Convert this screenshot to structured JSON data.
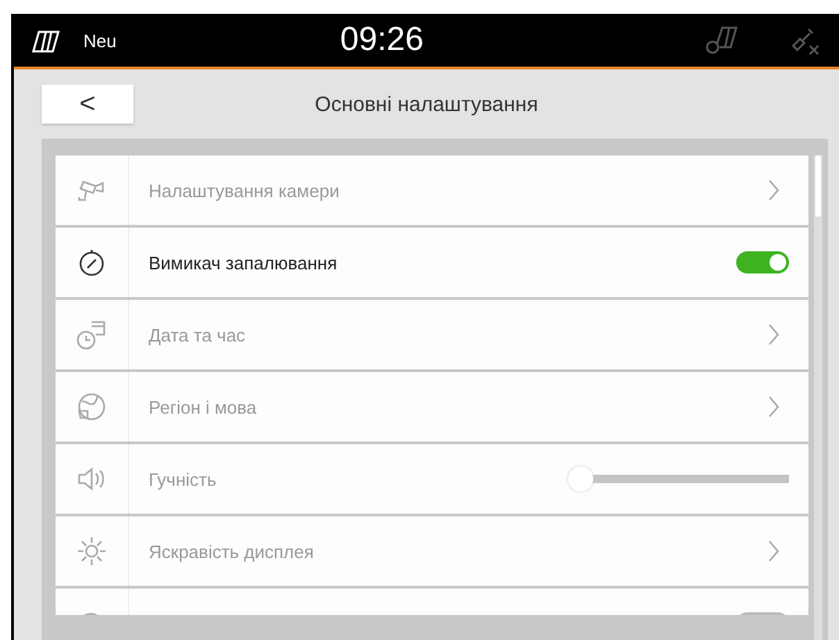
{
  "status_bar": {
    "label": "Neu",
    "time": "09:26"
  },
  "header": {
    "back": "<",
    "title": "Основні налаштування"
  },
  "rows": [
    {
      "kind": "link",
      "label": "Налаштування камери",
      "disabled": true
    },
    {
      "kind": "toggle",
      "label": "Вимикач запалювання",
      "disabled": false,
      "on": true
    },
    {
      "kind": "link",
      "label": "Дата та час",
      "disabled": true
    },
    {
      "kind": "link",
      "label": "Регіон і мова",
      "disabled": true
    },
    {
      "kind": "slider",
      "label": "Гучність",
      "disabled": true,
      "level": 0
    },
    {
      "kind": "link",
      "label": "Яскравість дисплея",
      "disabled": true
    },
    {
      "kind": "toggle",
      "disabled": true,
      "on": false
    }
  ]
}
